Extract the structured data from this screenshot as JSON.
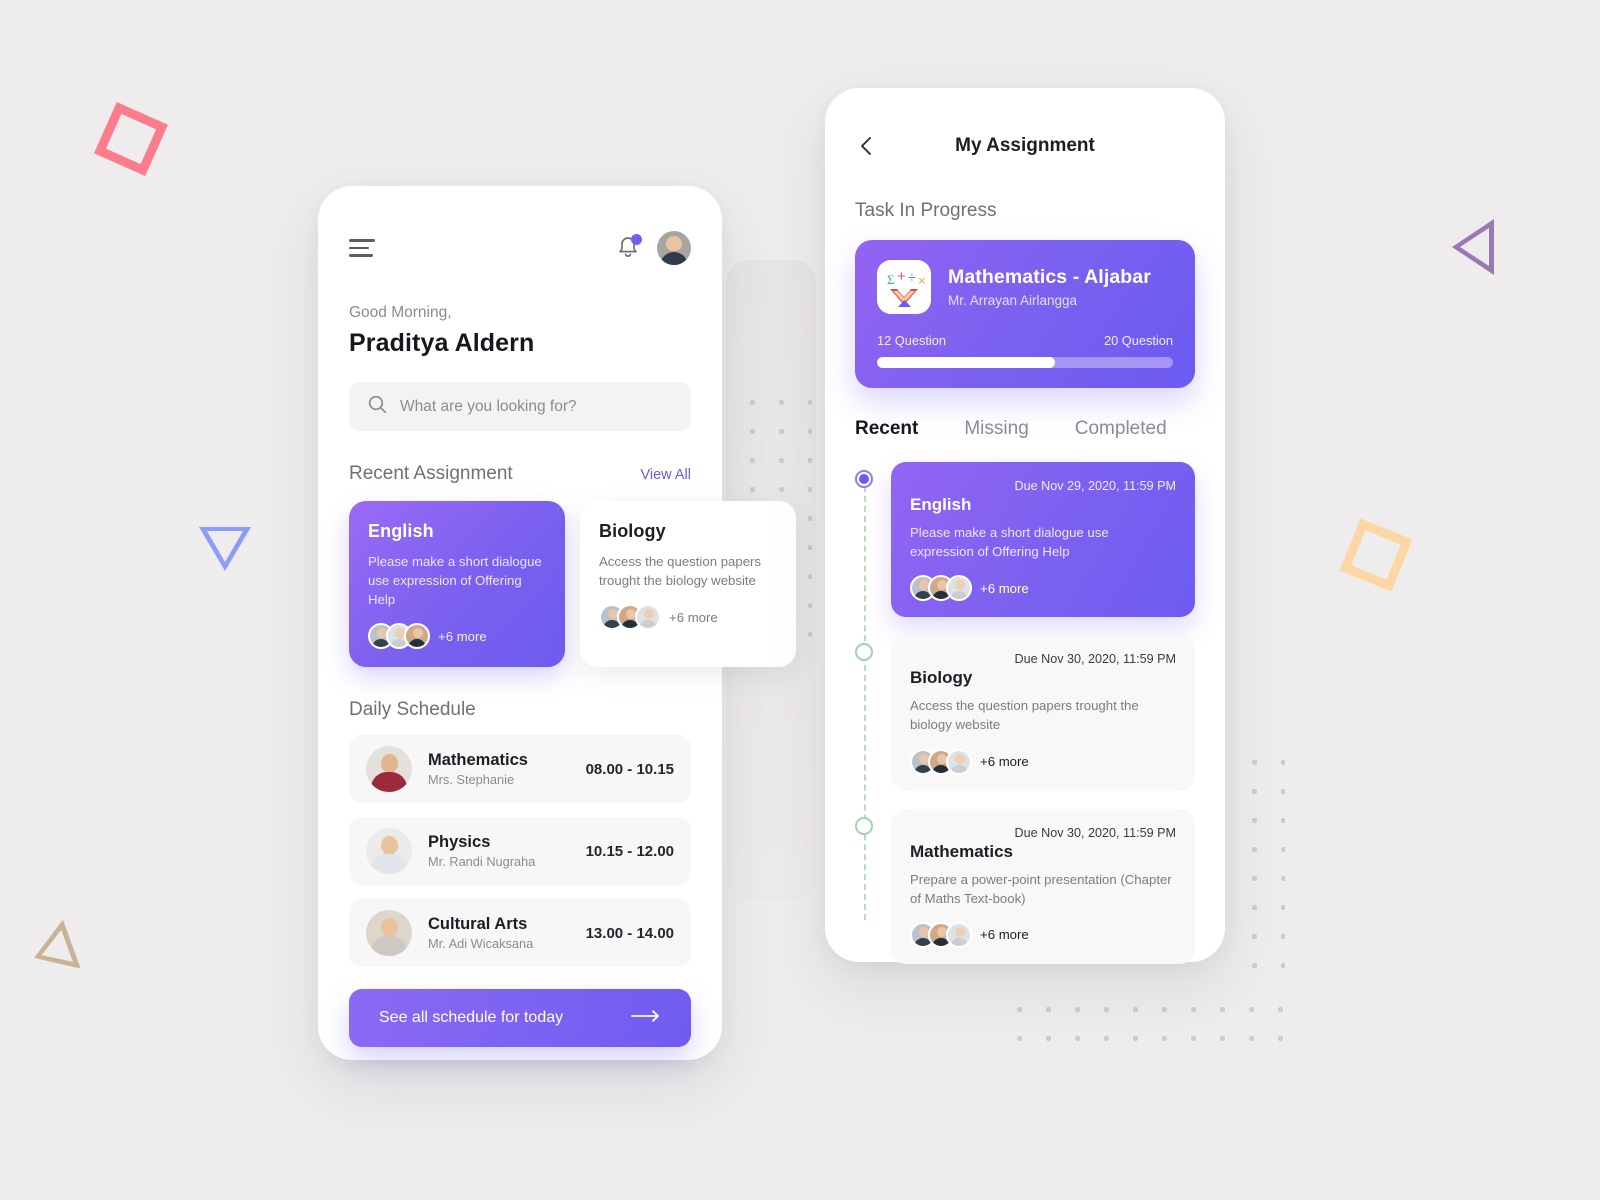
{
  "home": {
    "greeting": "Good Morning,",
    "user_name": "Praditya Aldern",
    "search": {
      "placeholder": "What are you looking for?",
      "value": ""
    },
    "recent_section": {
      "title": "Recent Assignment",
      "view_all": "View All"
    },
    "assignments": [
      {
        "subject": "English",
        "description": "Please make a short dialogue use expression of Offering Help",
        "more": "+6 more"
      },
      {
        "subject": "Biology",
        "description": "Access the question papers trought the biology website",
        "more": "+6 more"
      }
    ],
    "schedule_title": "Daily Schedule",
    "schedule": [
      {
        "subject": "Mathematics",
        "teacher": "Mrs. Stephanie",
        "time": "08.00 - 10.15"
      },
      {
        "subject": "Physics",
        "teacher": "Mr. Randi Nugraha",
        "time": "10.15 - 12.00"
      },
      {
        "subject": "Cultural Arts",
        "teacher": "Mr. Adi Wicaksana",
        "time": "13.00 - 14.00"
      }
    ],
    "cta_label": "See all schedule for today"
  },
  "assignment_page": {
    "title": "My Assignment",
    "task_section_title": "Task In Progress",
    "task": {
      "subject": "Mathematics - Aljabar",
      "teacher": "Mr. Arrayan Airlangga",
      "done_label": "12 Question",
      "total_label": "20 Question",
      "progress_percent": 60
    },
    "tabs": [
      {
        "label": "Recent",
        "active": true
      },
      {
        "label": "Missing",
        "active": false
      },
      {
        "label": "Completed",
        "active": false
      }
    ],
    "timeline": [
      {
        "due": "Due Nov 29, 2020, 11:59 PM",
        "subject": "English",
        "description": "Please make a short dialogue use expression of Offering Help",
        "more": "+6 more"
      },
      {
        "due": "Due Nov 30, 2020, 11:59 PM",
        "subject": "Biology",
        "description": "Access the question papers trought the biology website",
        "more": "+6 more"
      },
      {
        "due": "Due Nov 30, 2020, 11:59 PM",
        "subject": "Mathematics",
        "description": "Prepare a power-point presentation (Chapter of Maths Text-book)",
        "more": "+6 more"
      }
    ]
  },
  "theme": {
    "accent_purple": "#6a5af0",
    "accent_purple_light": "#9463f3",
    "background": "#eeecec",
    "deco_pink": "#fc7b8c",
    "deco_orange": "#fcd6a4",
    "deco_blue": "#8e9cf7",
    "deco_purple": "#9a78b5",
    "deco_tan": "#c9b295",
    "timeline_green": "#9fd3ab"
  }
}
